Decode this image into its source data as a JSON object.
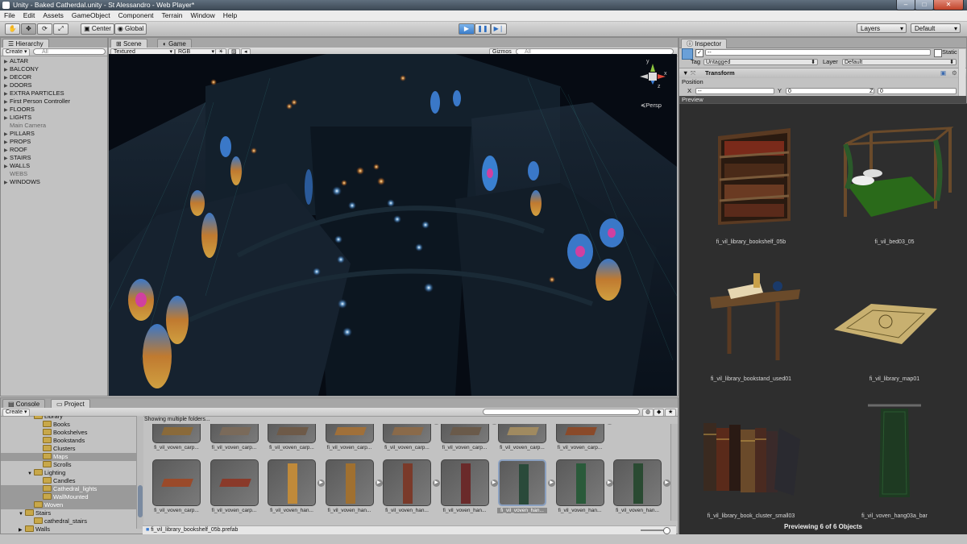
{
  "window": {
    "title": "Unity - Baked Catherdal.unity - St Alessandro - Web Player*",
    "minimize": "‒",
    "maximize": "□",
    "close": "✕"
  },
  "menu": [
    "File",
    "Edit",
    "Assets",
    "GameObject",
    "Component",
    "Terrain",
    "Window",
    "Help"
  ],
  "toolbar": {
    "pivot": "Center",
    "space": "Global",
    "layers": "Layers",
    "layout": "Default"
  },
  "hierarchy": {
    "tab": "Hierarchy",
    "create": "Create",
    "search_placeholder": "All",
    "items": [
      {
        "label": "ALTAR",
        "expandable": true
      },
      {
        "label": "BALCONY",
        "expandable": true
      },
      {
        "label": "DECOR",
        "expandable": true
      },
      {
        "label": "DOORS",
        "expandable": true
      },
      {
        "label": "EXTRA PARTICLES",
        "expandable": true
      },
      {
        "label": "First Person Controller",
        "expandable": true
      },
      {
        "label": "FLOORS",
        "expandable": true
      },
      {
        "label": "LIGHTS",
        "expandable": true
      },
      {
        "label": "Main Camera",
        "expandable": false
      },
      {
        "label": "PILLARS",
        "expandable": true
      },
      {
        "label": "PROPS",
        "expandable": true
      },
      {
        "label": "ROOF",
        "expandable": true
      },
      {
        "label": "STAIRS",
        "expandable": true
      },
      {
        "label": "WALLS",
        "expandable": true
      },
      {
        "label": "WEBS",
        "expandable": false
      },
      {
        "label": "WINDOWS",
        "expandable": true
      }
    ]
  },
  "scene": {
    "tab_scene": "Scene",
    "tab_game": "Game",
    "render_mode": "Textured",
    "color_mode": "RGB",
    "gizmos": "Gizmos",
    "search_placeholder": "All",
    "persp": "Persp",
    "gizmo_axes": {
      "y": "y",
      "x": "x",
      "z": "z"
    }
  },
  "inspector": {
    "tab": "Inspector",
    "name_value": "--",
    "static_label": "Static",
    "tag_label": "Tag",
    "tag_value": "Untagged",
    "layer_label": "Layer",
    "layer_value": "Default",
    "component": "Transform",
    "position_label": "Position",
    "x_label": "X",
    "x_value": "--",
    "y_label": "Y",
    "y_value": "0",
    "z_label": "Z",
    "z_value": "0",
    "preview_label": "Preview",
    "preview_items": [
      "fi_vil_library_bookshelf_05b",
      "fi_vil_bed03_05",
      "fi_vil_library_bookstand_used01",
      "fi_vil_library_map01",
      "fi_vil_library_book_cluster_small03",
      "fi_vil_voven_hang03a_bar"
    ],
    "previewing_text": "Previewing 6 of 6 Objects"
  },
  "bottom": {
    "tab_console": "Console",
    "tab_project": "Project",
    "create": "Create",
    "status": "Showing multiple folders...",
    "selected_path": "fi_vil_library_bookshelf_05b.prefab",
    "tree": [
      {
        "label": "Library",
        "indent": 3,
        "folder": true,
        "arrow": "",
        "sel": false
      },
      {
        "label": "Books",
        "indent": 4,
        "folder": true,
        "arrow": "",
        "sel": false
      },
      {
        "label": "Bookshelves",
        "indent": 4,
        "folder": true,
        "arrow": "",
        "sel": false
      },
      {
        "label": "Bookstands",
        "indent": 4,
        "folder": true,
        "arrow": "",
        "sel": false
      },
      {
        "label": "Clusters",
        "indent": 4,
        "folder": true,
        "arrow": "",
        "sel": false
      },
      {
        "label": "Maps",
        "indent": 4,
        "folder": true,
        "arrow": "",
        "sel": true
      },
      {
        "label": "Scrolls",
        "indent": 4,
        "folder": true,
        "arrow": "",
        "sel": false
      },
      {
        "label": "Lighting",
        "indent": 3,
        "folder": true,
        "arrow": "▼",
        "sel": false
      },
      {
        "label": "Candles",
        "indent": 4,
        "folder": true,
        "arrow": "",
        "sel": false
      },
      {
        "label": "Cathedral_lights",
        "indent": 4,
        "folder": true,
        "arrow": "",
        "sel": true
      },
      {
        "label": "WallMounted",
        "indent": 4,
        "folder": true,
        "arrow": "",
        "sel": true
      },
      {
        "label": "Woven",
        "indent": 3,
        "folder": true,
        "arrow": "",
        "sel": true
      },
      {
        "label": "Stairs",
        "indent": 2,
        "folder": true,
        "arrow": "▼",
        "sel": false
      },
      {
        "label": "cathedral_stairs",
        "indent": 3,
        "folder": true,
        "arrow": "",
        "sel": false
      },
      {
        "label": "Walls",
        "indent": 2,
        "folder": true,
        "arrow": "▶",
        "sel": false
      }
    ],
    "row1": [
      {
        "label": "fi_vil_voven_carp...",
        "color": "#8a6a3a",
        "play": false
      },
      {
        "label": "fi_vil_voven_carp...",
        "color": "#7a6a5a",
        "play": false
      },
      {
        "label": "fi_vil_voven_carp...",
        "color": "#6e5a48",
        "play": false
      },
      {
        "label": "fi_vil_voven_carp...",
        "color": "#a0703a",
        "play": false
      },
      {
        "label": "fi_vil_voven_carp...",
        "color": "#8a6a4a",
        "play": true
      },
      {
        "label": "fi_vil_voven_carp...",
        "color": "#6a5a4a",
        "play": true
      },
      {
        "label": "fi_vil_voven_carp...",
        "color": "#a08a60",
        "play": false
      },
      {
        "label": "fi_vil_voven_carp...",
        "color": "#8a4a2a",
        "play": true
      }
    ],
    "row2": [
      {
        "label": "fi_vil_voven_carp...",
        "color": "#9a4a2a",
        "play": false
      },
      {
        "label": "fi_vil_voven_carp...",
        "color": "#8a3a2a",
        "play": false
      },
      {
        "label": "fi_vil_voven_han...",
        "color": "#c08a3a",
        "play": true
      },
      {
        "label": "fi_vil_voven_han...",
        "color": "#a07030",
        "play": true
      },
      {
        "label": "fi_vil_voven_han...",
        "color": "#7a3a2a",
        "play": true
      },
      {
        "label": "fi_vil_voven_han...",
        "color": "#6a2a2a",
        "play": true
      },
      {
        "label": "fi_vil_voven_han...",
        "color": "#2a4a3a",
        "play": true
      },
      {
        "label": "fi_vil_voven_han...",
        "color": "#2a5a3a",
        "play": true
      },
      {
        "label": "fi_vil_voven_han...",
        "color": "#2a4a32",
        "play": true
      }
    ]
  }
}
